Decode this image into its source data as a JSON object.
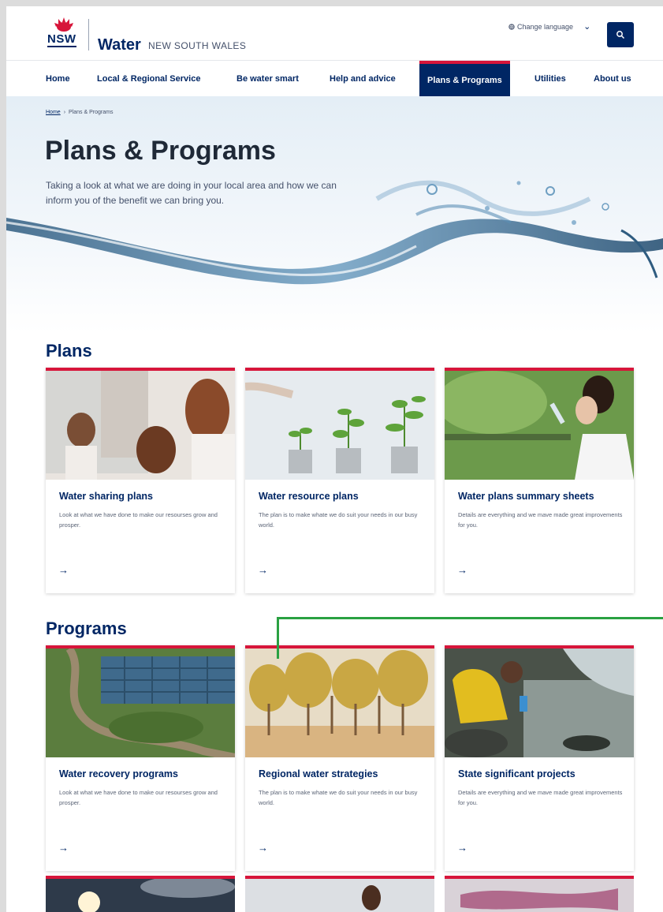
{
  "header": {
    "brand_short": "NSW",
    "brand_name": "Water",
    "brand_sub": "NEW SOUTH WALES",
    "language_label": "Change language",
    "search_icon": "search-icon"
  },
  "nav": {
    "items": [
      {
        "label": "Home"
      },
      {
        "label": "Local & Regional Service"
      },
      {
        "label": "Be water smart"
      },
      {
        "label": "Help and advice"
      },
      {
        "label": "Plans & Programs"
      },
      {
        "label": "Utilities"
      },
      {
        "label": "About us"
      }
    ],
    "active_index": 4
  },
  "breadcrumb": {
    "home": "Home",
    "separator": "›",
    "current": "Plans & Programs"
  },
  "hero": {
    "title": "Plans & Programs",
    "description": "Taking a look at what we are doing in your local area and how we can inform you of the benefit we can bring you."
  },
  "plans": {
    "title": "Plans",
    "cards": [
      {
        "title": "Water sharing plans",
        "desc": "Look at what we have done to make our resourses grow and prosper.",
        "arrow": "→"
      },
      {
        "title": "Water resource plans",
        "desc": "The plan is to make whate we do suit your needs in our busy world.",
        "arrow": "→"
      },
      {
        "title": "Water plans summary sheets",
        "desc": "Details are everything and we mave made great improvements for you.",
        "arrow": "→"
      }
    ]
  },
  "programs": {
    "title": "Programs",
    "cards": [
      {
        "title": "Water recovery programs",
        "desc": "Look at what we have done to make our resourses grow and prosper.",
        "arrow": "→"
      },
      {
        "title": "Regional water strategies",
        "desc": "The plan is to make whate we do suit your needs in our busy world.",
        "arrow": "→"
      },
      {
        "title": "State significant projects",
        "desc": "Details are everything and we mave made great improvements for you.",
        "arrow": "→"
      }
    ]
  },
  "colors": {
    "navy": "#002664",
    "accent_red": "#d7153a",
    "annotation_green": "#2aa142"
  }
}
